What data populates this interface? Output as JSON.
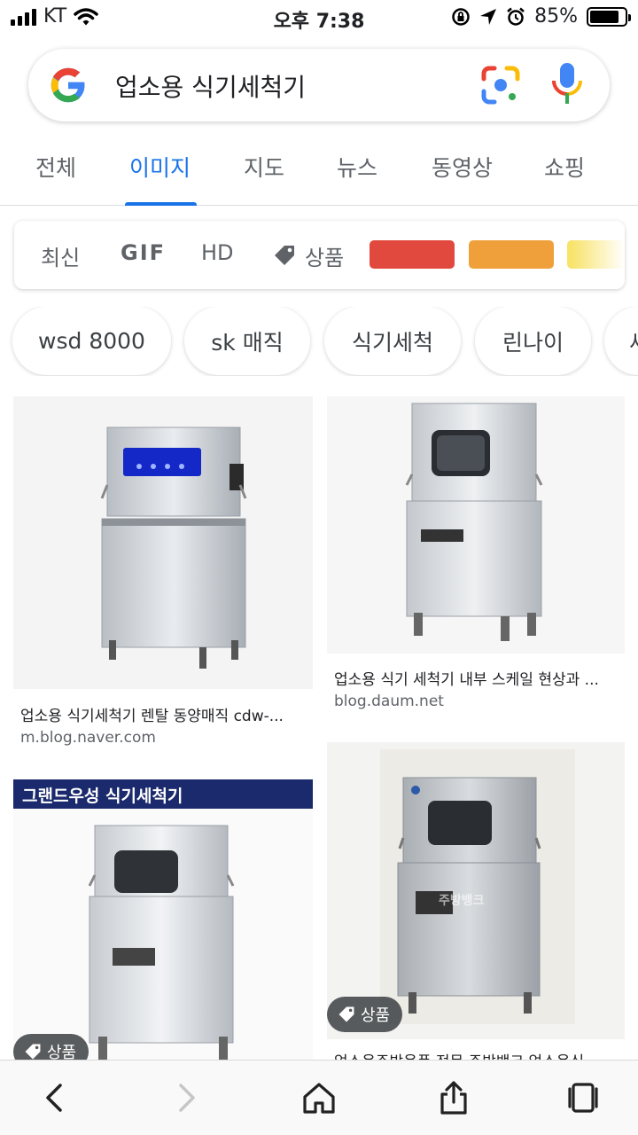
{
  "status_bar": {
    "carrier": "KT",
    "time": "오후 7:38",
    "battery_percent": "85%",
    "battery_level": 0.85
  },
  "search": {
    "query": "업소용 식기세척기",
    "icons": [
      "google-logo",
      "lens-icon",
      "mic-icon"
    ]
  },
  "tabs": [
    {
      "label": "전체",
      "active": false
    },
    {
      "label": "이미지",
      "active": true
    },
    {
      "label": "지도",
      "active": false
    },
    {
      "label": "뉴스",
      "active": false
    },
    {
      "label": "동영상",
      "active": false
    },
    {
      "label": "쇼핑",
      "active": false
    }
  ],
  "filters": {
    "latest": "최신",
    "gif": "GIF",
    "hd": "HD",
    "products": "상품",
    "colors": [
      "#e2493e",
      "#f0a03b",
      "#f8e36b"
    ]
  },
  "chips": [
    "wsd 8000",
    "sk 매직",
    "식기세척",
    "린나이",
    "세"
  ],
  "results": [
    {
      "title": "업소용 식기세척기 렌탈 동양매직 cdw-...",
      "source": "m.blog.naver.com"
    },
    {
      "title": "업소용 식기 세척기 내부 스케일 현상과 ...",
      "source": "blog.daum.net"
    },
    {
      "banner": "그랜드우성 식기세척기",
      "badge": "상품"
    },
    {
      "title": "업소용주방용품 전문 주방뱅크 업소용식...",
      "badge": "상품",
      "watermark": "주방뱅크"
    }
  ],
  "toolbar": [
    "back-icon",
    "forward-icon",
    "home-icon",
    "share-icon",
    "tabs-icon"
  ]
}
